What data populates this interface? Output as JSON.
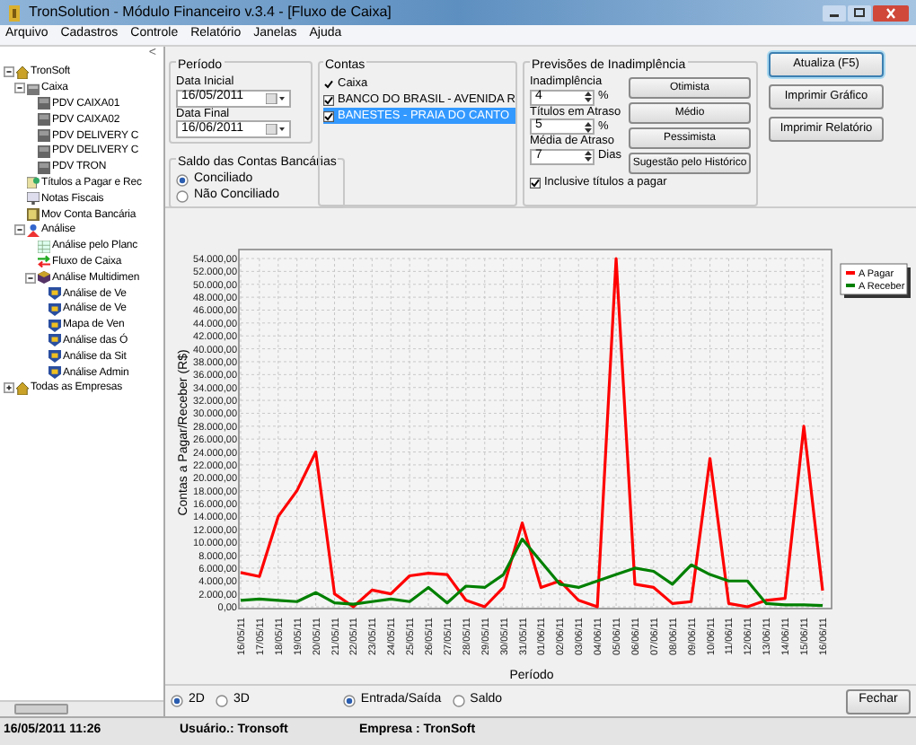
{
  "window": {
    "title": "TronSolution - Módulo Financeiro v.3.4 - [Fluxo de Caixa]"
  },
  "menu": [
    "Arquivo",
    "Cadastros",
    "Controle",
    "Relatório",
    "Janelas",
    "Ajuda"
  ],
  "sidebar": {
    "collapse": "<",
    "tree": [
      {
        "label": "TronSoft",
        "kind": "home",
        "expanded": true,
        "children": [
          {
            "label": "Caixa",
            "kind": "register",
            "expanded": true,
            "children": [
              {
                "label": "PDV CAIXA01",
                "kind": "device"
              },
              {
                "label": "PDV CAIXA02",
                "kind": "device"
              },
              {
                "label": "PDV DELIVERY C",
                "kind": "device"
              },
              {
                "label": "PDV DELIVERY C",
                "kind": "device"
              },
              {
                "label": "PDV TRON",
                "kind": "device"
              }
            ]
          },
          {
            "label": "Títulos a Pagar e Rec",
            "kind": "docs"
          },
          {
            "label": "Notas Fiscais",
            "kind": "notes"
          },
          {
            "label": "Mov Conta Bancária",
            "kind": "bank"
          },
          {
            "label": "Análise",
            "kind": "analysis",
            "expanded": true,
            "children": [
              {
                "label": "Análise pelo Planc",
                "kind": "sheet"
              },
              {
                "label": "Fluxo de Caixa",
                "kind": "flow"
              },
              {
                "label": "Análise Multidimen",
                "kind": "cube",
                "expanded": true,
                "children": [
                  {
                    "label": "Análise de Ve",
                    "kind": "report"
                  },
                  {
                    "label": "Análise de Ve",
                    "kind": "report"
                  },
                  {
                    "label": "Mapa de Ven",
                    "kind": "report"
                  },
                  {
                    "label": "Análise das Ó",
                    "kind": "report"
                  },
                  {
                    "label": "Análise da Sit",
                    "kind": "report"
                  },
                  {
                    "label": "Análise Admin",
                    "kind": "report"
                  }
                ]
              }
            ]
          }
        ]
      },
      {
        "label": "Todas as Empresas",
        "kind": "home",
        "expanded": false
      }
    ]
  },
  "periodo": {
    "title": "Período",
    "fields": [
      {
        "label": "Data Inicial",
        "value": "16/05/2011"
      },
      {
        "label": "Data Final",
        "value": "16/06/2011"
      }
    ]
  },
  "saldo": {
    "title": "Saldo das Contas Bancárias",
    "options": [
      {
        "label": "Conciliado",
        "selected": true
      },
      {
        "label": "Não Conciliado",
        "selected": false
      }
    ]
  },
  "contas": {
    "title": "Contas",
    "items": [
      {
        "label": "Caixa",
        "kind": "tick",
        "checked": true,
        "selected": false
      },
      {
        "label": "BANCO DO BRASIL - AVENIDA R",
        "kind": "box",
        "checked": true,
        "selected": false
      },
      {
        "label": "BANESTES - PRAIA DO CANTO",
        "kind": "box",
        "checked": true,
        "selected": true
      }
    ]
  },
  "previsoes": {
    "title": "Previsões de Inadimplência",
    "fields": [
      {
        "label": "Inadimplência",
        "value": "4",
        "unit": "%"
      },
      {
        "label": "Títulos em Atraso",
        "value": "5",
        "unit": "%"
      },
      {
        "label": "Média de Atraso",
        "value": "7",
        "unit": "Dias"
      }
    ],
    "buttons": [
      "Otimista",
      "Médio",
      "Pessimista",
      "Sugestão pelo Histórico"
    ],
    "include": {
      "label": "Inclusive títulos a pagar",
      "checked": true
    }
  },
  "actions": [
    {
      "label": "Atualiza (F5)",
      "default": true
    },
    {
      "label": "Imprimir Gráfico",
      "default": false
    },
    {
      "label": "Imprimir Relatório",
      "default": false
    }
  ],
  "chart": {
    "chart_data": {
      "type": "line",
      "xlabel": "Período",
      "ylabel": "Contas a Pagar/Receber (R$)",
      "categories": [
        "16/05/11",
        "17/05/11",
        "18/05/11",
        "19/05/11",
        "20/05/11",
        "21/05/11",
        "22/05/11",
        "23/05/11",
        "24/05/11",
        "25/05/11",
        "26/05/11",
        "27/05/11",
        "28/05/11",
        "29/05/11",
        "30/05/11",
        "31/05/11",
        "01/06/11",
        "02/06/11",
        "03/06/11",
        "04/06/11",
        "05/06/11",
        "06/06/11",
        "07/06/11",
        "08/06/11",
        "09/06/11",
        "10/06/11",
        "11/06/11",
        "12/06/11",
        "13/06/11",
        "14/06/11",
        "15/06/11",
        "16/06/11"
      ],
      "series": [
        {
          "name": "A Pagar",
          "color": "#ff0000",
          "values": [
            5300,
            4700,
            14000,
            18000,
            24000,
            2000,
            0,
            2600,
            2000,
            4800,
            5200,
            5000,
            1000,
            0,
            3000,
            13000,
            3000,
            4000,
            1000,
            0,
            54000,
            3500,
            3000,
            500,
            800,
            23000,
            500,
            0,
            1000,
            1300,
            28000,
            2500
          ]
        },
        {
          "name": "A Receber",
          "color": "#008000",
          "values": [
            1000,
            1200,
            1000,
            800,
            2200,
            600,
            400,
            800,
            1200,
            800,
            3000,
            600,
            3200,
            3000,
            5000,
            10500,
            7000,
            3500,
            3000,
            4000,
            5000,
            6000,
            5500,
            3500,
            6500,
            5000,
            4000,
            4000,
            500,
            300,
            300,
            200
          ]
        }
      ],
      "ylim": [
        0,
        54000
      ],
      "grid": true,
      "legend": "upper right",
      "yticks": [
        {
          "value": 0,
          "label": "0,00"
        },
        {
          "value": 2000,
          "label": "2.000,00"
        },
        {
          "value": 4000,
          "label": "4.000,00"
        },
        {
          "value": 6000,
          "label": "6.000,00"
        },
        {
          "value": 8000,
          "label": "8.000,00"
        },
        {
          "value": 10000,
          "label": "10.000,00"
        },
        {
          "value": 12000,
          "label": "12.000,00"
        },
        {
          "value": 14000,
          "label": "14.000,00"
        },
        {
          "value": 16000,
          "label": "16.000,00"
        },
        {
          "value": 18000,
          "label": "18.000,00"
        },
        {
          "value": 20000,
          "label": "20.000,00"
        },
        {
          "value": 22000,
          "label": "22.000,00"
        },
        {
          "value": 24000,
          "label": "24.000,00"
        },
        {
          "value": 26000,
          "label": "26.000,00"
        },
        {
          "value": 28000,
          "label": "28.000,00"
        },
        {
          "value": 30000,
          "label": "30.000,00"
        },
        {
          "value": 32000,
          "label": "32.000,00"
        },
        {
          "value": 34000,
          "label": "34.000,00"
        },
        {
          "value": 36000,
          "label": "36.000,00"
        },
        {
          "value": 38000,
          "label": "38.000,00"
        },
        {
          "value": 40000,
          "label": "40.000,00"
        },
        {
          "value": 42000,
          "label": "42.000,00"
        },
        {
          "value": 44000,
          "label": "44.000,00"
        },
        {
          "value": 46000,
          "label": "46.000,00"
        },
        {
          "value": 48000,
          "label": "48.000,00"
        },
        {
          "value": 50000,
          "label": "50.000,00"
        },
        {
          "value": 52000,
          "label": "52.000,00"
        },
        {
          "value": 54000,
          "label": "54.000,00"
        }
      ]
    }
  },
  "view_options": [
    {
      "label": "2D",
      "selected": true
    },
    {
      "label": "3D",
      "selected": false
    }
  ],
  "mode_options": [
    {
      "label": "Entrada/Saída",
      "selected": true
    },
    {
      "label": "Saldo",
      "selected": false
    }
  ],
  "close_button": "Fechar",
  "status_bar": {
    "datetime": "16/05/2011 11:26",
    "user": "Usuário.: Tronsoft",
    "company": "Empresa : TronSoft"
  }
}
